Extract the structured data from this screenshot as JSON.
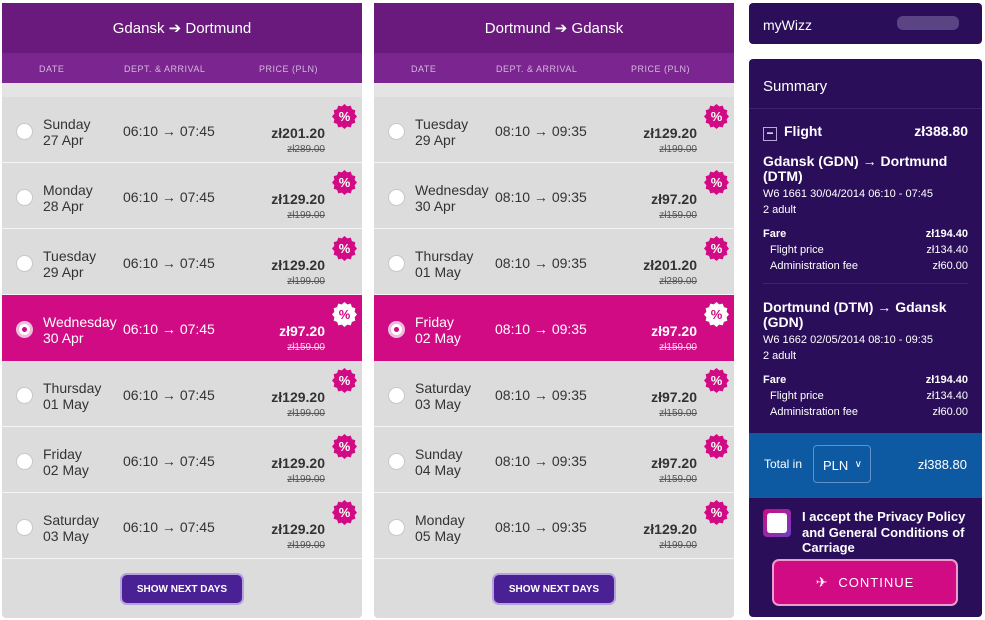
{
  "outbound": {
    "title": "Gdansk ➔ Dortmund",
    "headers": {
      "date": "DATE",
      "dept": "DEPT. & ARRIVAL",
      "price": "PRICE (PLN)"
    },
    "rows": [
      {
        "day": "Sunday",
        "date": "27 Apr",
        "time": "06:10 → 07:45",
        "price": "zł201.20",
        "old": "zł289.00",
        "selected": false
      },
      {
        "day": "Monday",
        "date": "28 Apr",
        "time": "06:10 → 07:45",
        "price": "zł129.20",
        "old": "zł199.00",
        "selected": false
      },
      {
        "day": "Tuesday",
        "date": "29 Apr",
        "time": "06:10 → 07:45",
        "price": "zł129.20",
        "old": "zł199.00",
        "selected": false
      },
      {
        "day": "Wednesday",
        "date": "30 Apr",
        "time": "06:10 → 07:45",
        "price": "zł97.20",
        "old": "zł159.00",
        "selected": true
      },
      {
        "day": "Thursday",
        "date": "01 May",
        "time": "06:10 → 07:45",
        "price": "zł129.20",
        "old": "zł199.00",
        "selected": false
      },
      {
        "day": "Friday",
        "date": "02 May",
        "time": "06:10 → 07:45",
        "price": "zł129.20",
        "old": "zł199.00",
        "selected": false
      },
      {
        "day": "Saturday",
        "date": "03 May",
        "time": "06:10 → 07:45",
        "price": "zł129.20",
        "old": "zł199.00",
        "selected": false
      }
    ],
    "next_label": "SHOW NEXT DAYS"
  },
  "inbound": {
    "title": "Dortmund ➔ Gdansk",
    "headers": {
      "date": "DATE",
      "dept": "DEPT. & ARRIVAL",
      "price": "PRICE (PLN)"
    },
    "rows": [
      {
        "day": "Tuesday",
        "date": "29 Apr",
        "time": "08:10 → 09:35",
        "price": "zł129.20",
        "old": "zł199.00",
        "selected": false
      },
      {
        "day": "Wednesday",
        "date": "30 Apr",
        "time": "08:10 → 09:35",
        "price": "zł97.20",
        "old": "zł159.00",
        "selected": false
      },
      {
        "day": "Thursday",
        "date": "01 May",
        "time": "08:10 → 09:35",
        "price": "zł201.20",
        "old": "zł289.00",
        "selected": false
      },
      {
        "day": "Friday",
        "date": "02 May",
        "time": "08:10 → 09:35",
        "price": "zł97.20",
        "old": "zł159.00",
        "selected": true
      },
      {
        "day": "Saturday",
        "date": "03 May",
        "time": "08:10 → 09:35",
        "price": "zł97.20",
        "old": "zł159.00",
        "selected": false
      },
      {
        "day": "Sunday",
        "date": "04 May",
        "time": "08:10 → 09:35",
        "price": "zł97.20",
        "old": "zł159.00",
        "selected": false
      },
      {
        "day": "Monday",
        "date": "05 May",
        "time": "08:10 → 09:35",
        "price": "zł129.20",
        "old": "zł199.00",
        "selected": false
      }
    ],
    "next_label": "SHOW NEXT DAYS"
  },
  "mywizz": {
    "label": "myWizz"
  },
  "summary": {
    "title": "Summary",
    "flight_label": "Flight",
    "flight_total": "zł388.80",
    "legs": [
      {
        "route": "Gdansk (GDN) → Dortmund (DTM)",
        "flight": "W6 1661  30/04/2014 06:10 - 07:45",
        "pax": "2 adult",
        "fare_label": "Fare",
        "fare": "zł194.40",
        "price_label": "Flight price",
        "price": "zł134.40",
        "admin_label": "Administration fee",
        "admin": "zł60.00"
      },
      {
        "route": "Dortmund (DTM) → Gdansk (GDN)",
        "flight": "W6 1662  02/05/2014 08:10 - 09:35",
        "pax": "2 adult",
        "fare_label": "Fare",
        "fare": "zł194.40",
        "price_label": "Flight price",
        "price": "zł134.40",
        "admin_label": "Administration fee",
        "admin": "zł60.00"
      }
    ],
    "total_label": "Total in",
    "currency": "PLN",
    "total": "zł388.80",
    "accept_text": "I accept the Privacy Policy and General Conditions of Carriage",
    "continue_label": "CONTINUE"
  },
  "colors": {
    "purple": "#6a1a7c",
    "magenta": "#d10b83",
    "navy": "#2b0e5a",
    "blue": "#0d5aa3"
  },
  "icons": {
    "discount": "percent-badge-icon",
    "plane": "plane-takeoff-icon",
    "chevron": "chevron-down-icon",
    "collapse": "minus-icon"
  }
}
